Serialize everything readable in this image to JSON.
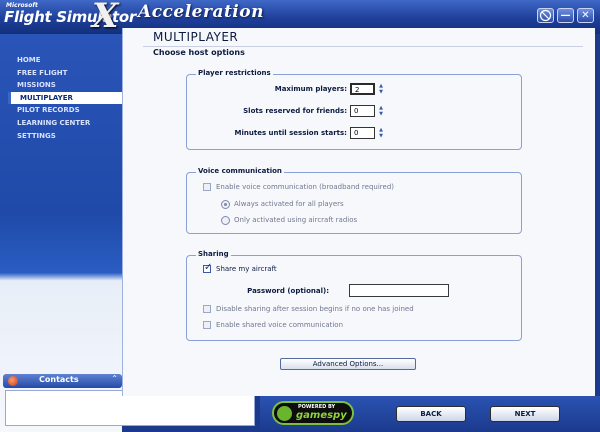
{
  "app": {
    "brand_small": "Microsoft",
    "brand_name": "Flight Simulator",
    "brand_x": "X",
    "brand_edition": "Acceleration"
  },
  "window_controls": {
    "extra_icon": "compass-icon",
    "minimize_glyph": "—",
    "close_glyph": "✕"
  },
  "sidebar": {
    "items": [
      {
        "label": "HOME"
      },
      {
        "label": "FREE FLIGHT"
      },
      {
        "label": "MISSIONS"
      },
      {
        "label": "MULTIPLAYER",
        "active": true
      },
      {
        "label": "PILOT RECORDS"
      },
      {
        "label": "LEARNING CENTER"
      },
      {
        "label": "SETTINGS"
      }
    ]
  },
  "contacts": {
    "label": "Contacts"
  },
  "page": {
    "title": "MULTIPLAYER",
    "subtitle": "Choose host options"
  },
  "player_restrictions": {
    "title": "Player restrictions",
    "max_players_label": "Maximum players:",
    "max_players_value": "2",
    "slots_reserved_label": "Slots reserved for friends:",
    "slots_reserved_value": "0",
    "minutes_until_start_label": "Minutes until session starts:",
    "minutes_until_start_value": "0"
  },
  "voice": {
    "title": "Voice communication",
    "enable_label": "Enable voice communication (broadband required)",
    "enable_checked": false,
    "option_always": "Always activated for all players",
    "option_radios": "Only activated using aircraft radios"
  },
  "sharing": {
    "title": "Sharing",
    "share_label": "Share my aircraft",
    "share_checked": true,
    "password_label": "Password (optional):",
    "password_value": "",
    "disable_after_label": "Disable sharing after session begins if no one has joined",
    "shared_voice_label": "Enable shared voice communication"
  },
  "advanced_button": "Advanced Options...",
  "footer": {
    "powered_by": "POWERED BY",
    "gamespy": "gamespy",
    "back_label": "BACK",
    "next_label": "NEXT"
  },
  "colors": {
    "frame_blue": "#1b3a8c",
    "accent": "#3b66c8",
    "text": "#0d1b40"
  }
}
